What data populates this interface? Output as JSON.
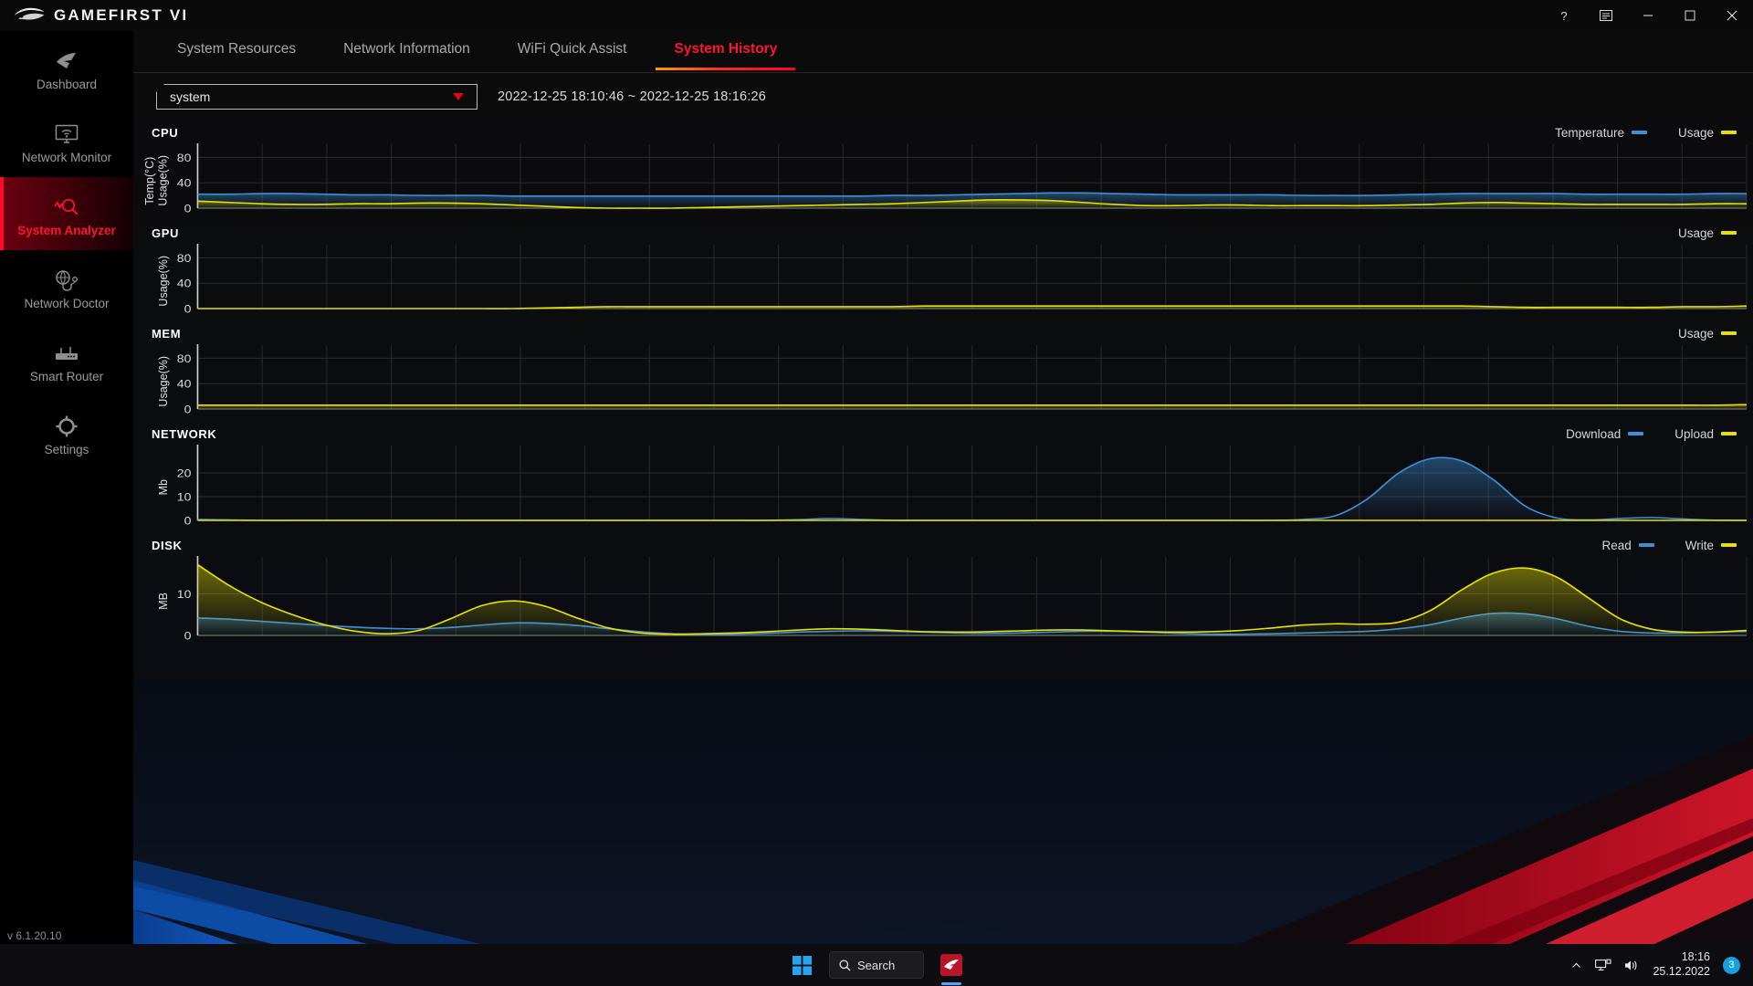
{
  "window": {
    "title": "GAMEFIRST VI",
    "logo_icon": "rog-logo-icon",
    "controls": [
      {
        "name": "help-button",
        "icon": "question-mark-icon",
        "label": "?"
      },
      {
        "name": "notes-button",
        "icon": "note-icon",
        "label": ""
      },
      {
        "name": "minimize-button",
        "icon": "minimize-icon",
        "label": ""
      },
      {
        "name": "maximize-button",
        "icon": "maximize-icon",
        "label": ""
      },
      {
        "name": "close-button",
        "icon": "close-icon",
        "label": ""
      }
    ]
  },
  "sidebar": {
    "items": [
      {
        "label": "Dashboard",
        "icon": "dashboard-icon",
        "active": false
      },
      {
        "label": "Network Monitor",
        "icon": "monitor-wifi-icon",
        "active": false
      },
      {
        "label": "System Analyzer",
        "icon": "magnifier-pulse-icon",
        "active": true
      },
      {
        "label": "Network Doctor",
        "icon": "stethoscope-globe-icon",
        "active": false
      },
      {
        "label": "Smart Router",
        "icon": "router-icon",
        "active": false
      },
      {
        "label": "Settings",
        "icon": "gear-icon",
        "active": false
      }
    ],
    "version": "v 6.1.20.10"
  },
  "tabs": [
    {
      "label": "System Resources",
      "active": false
    },
    {
      "label": "Network Information",
      "active": false
    },
    {
      "label": "WiFi Quick Assist",
      "active": false
    },
    {
      "label": "System History",
      "active": true
    }
  ],
  "toolbar": {
    "profile_select": {
      "value": "system",
      "caret_icon": "chevron-down-icon"
    },
    "time_range": "2022-12-25 18:10:46 ~ 2022-12-25 18:16:26"
  },
  "colors": {
    "accent_red": "#ff1430",
    "series_blue": "#3d8fd8",
    "series_yellow": "#e8e000",
    "grid": "#2a2a2a",
    "background": "#0a0a0a"
  },
  "taskbar": {
    "start_icon": "windows-start-icon",
    "search_label": "Search",
    "search_icon": "search-icon",
    "app_icon": "gamefirst-taskbar-icon",
    "chevron_icon": "chevron-up-icon",
    "network_icon": "network-icon",
    "volume_icon": "volume-icon",
    "time": "18:16",
    "date": "25.12.2022",
    "badge_count": "3"
  },
  "chart_data": [
    {
      "type": "area",
      "title": "CPU",
      "ylabel": "Temp(°C)\nUsage(%)",
      "ylabel_lines": [
        "Temp(°C)",
        "Usage(%)"
      ],
      "yticks": [
        0,
        40,
        80
      ],
      "ylim": [
        0,
        95
      ],
      "grid": true,
      "legend_position": "top-right",
      "series": [
        {
          "name": "Temperature",
          "color": "#3d8fd8",
          "values": [
            22,
            22,
            23,
            23,
            22,
            21,
            21,
            20,
            20,
            20,
            19,
            19,
            19,
            19,
            19,
            19,
            19,
            19,
            19,
            19,
            19,
            19,
            20,
            20,
            21,
            22,
            23,
            24,
            24,
            23,
            22,
            21,
            21,
            21,
            21,
            20,
            20,
            20,
            21,
            22,
            23,
            23,
            23,
            23,
            22,
            22,
            22,
            22,
            23,
            23
          ]
        },
        {
          "name": "Usage",
          "color": "#e8e000",
          "values": [
            11,
            9,
            7,
            6,
            6,
            7,
            7,
            8,
            8,
            7,
            5,
            3,
            1,
            0,
            0,
            0,
            1,
            2,
            3,
            4,
            5,
            6,
            7,
            9,
            11,
            13,
            13,
            12,
            9,
            6,
            4,
            4,
            5,
            5,
            4,
            4,
            4,
            4,
            5,
            6,
            8,
            9,
            8,
            7,
            6,
            6,
            6,
            6,
            7,
            7
          ]
        }
      ]
    },
    {
      "type": "area",
      "title": "GPU",
      "ylabel": "Usage(%)",
      "ylabel_lines": [
        "Usage(%)"
      ],
      "yticks": [
        0,
        40,
        80
      ],
      "ylim": [
        0,
        95
      ],
      "grid": true,
      "legend_position": "top-right",
      "series": [
        {
          "name": "Usage",
          "color": "#e8e000",
          "values": [
            0,
            0,
            0,
            0,
            0,
            0,
            0,
            0,
            0,
            0,
            0,
            1,
            2,
            3,
            3,
            3,
            3,
            3,
            3,
            3,
            3,
            3,
            3,
            4,
            4,
            4,
            4,
            4,
            4,
            4,
            4,
            4,
            4,
            4,
            4,
            4,
            4,
            4,
            4,
            4,
            4,
            3,
            2,
            2,
            2,
            2,
            2,
            3,
            3,
            4
          ]
        }
      ]
    },
    {
      "type": "area",
      "title": "MEM",
      "ylabel": "Usage(%)",
      "ylabel_lines": [
        "Usage(%)"
      ],
      "yticks": [
        0,
        40,
        80
      ],
      "ylim": [
        0,
        95
      ],
      "grid": true,
      "legend_position": "top-right",
      "series": [
        {
          "name": "Usage",
          "color": "#e8e000",
          "values": [
            6,
            6,
            6,
            6,
            6,
            6,
            6,
            6,
            6,
            6,
            6,
            6,
            6,
            6,
            6,
            6,
            6,
            6,
            6,
            6,
            6,
            6,
            6,
            6,
            6,
            6,
            6,
            6,
            6,
            6,
            6,
            6,
            6,
            6,
            6,
            6,
            6,
            6,
            6,
            6,
            6,
            6,
            6,
            6,
            6,
            6,
            6,
            6,
            6,
            7
          ]
        }
      ]
    },
    {
      "type": "area",
      "title": "NETWORK",
      "ylabel": "Mb",
      "ylabel_lines": [
        "Mb"
      ],
      "yticks": [
        0,
        10,
        20
      ],
      "ylim": [
        0,
        30
      ],
      "grid": true,
      "legend_position": "top-right",
      "series": [
        {
          "name": "Download",
          "color": "#3d8fd8",
          "values": [
            0.4,
            0.2,
            0,
            0,
            0,
            0,
            0,
            0,
            0,
            0,
            0,
            0,
            0,
            0,
            0,
            0,
            0,
            0,
            0,
            0.3,
            0.8,
            0.4,
            0,
            0,
            0,
            0,
            0,
            0,
            0,
            0,
            0,
            0,
            0,
            0,
            0,
            0.4,
            2,
            9,
            20,
            26,
            25,
            17,
            6,
            1,
            0.2,
            0.8,
            1.2,
            0.6,
            0.1,
            0
          ]
        },
        {
          "name": "Upload",
          "color": "#e8e000",
          "values": [
            0,
            0,
            0,
            0,
            0,
            0,
            0,
            0,
            0,
            0,
            0,
            0,
            0,
            0,
            0,
            0,
            0,
            0,
            0,
            0,
            0,
            0,
            0,
            0,
            0,
            0,
            0,
            0,
            0,
            0,
            0,
            0,
            0,
            0,
            0,
            0,
            0,
            0,
            0,
            0,
            0,
            0,
            0,
            0,
            0,
            0,
            0,
            0,
            0,
            0
          ]
        }
      ]
    },
    {
      "type": "area",
      "title": "DISK",
      "ylabel": "MB",
      "ylabel_lines": [
        "MB"
      ],
      "yticks": [
        0,
        10
      ],
      "ylim": [
        0,
        18
      ],
      "grid": true,
      "legend_position": "top-right",
      "series": [
        {
          "name": "Read",
          "color": "#3d8fd8",
          "values": [
            4.2,
            3.9,
            3.4,
            2.9,
            2.4,
            2.0,
            1.7,
            1.6,
            1.9,
            2.5,
            3.0,
            2.9,
            2.4,
            1.6,
            0.9,
            0.4,
            0.2,
            0.3,
            0.5,
            0.8,
            1.0,
            1.1,
            1.0,
            0.8,
            0.6,
            0.5,
            0.6,
            0.8,
            1.0,
            1.0,
            0.8,
            0.5,
            0.3,
            0.3,
            0.4,
            0.6,
            0.8,
            1.0,
            1.6,
            2.6,
            4.2,
            5.3,
            5.2,
            4.0,
            2.2,
            1.0,
            0.6,
            0.6,
            0.8,
            1.0
          ]
        },
        {
          "name": "Write",
          "color": "#e8e000",
          "values": [
            17,
            12,
            8,
            5,
            2.6,
            1.0,
            0.4,
            1.2,
            4.0,
            7.2,
            8.3,
            7.0,
            4.2,
            1.8,
            0.6,
            0.3,
            0.4,
            0.6,
            0.9,
            1.3,
            1.6,
            1.5,
            1.2,
            0.9,
            0.8,
            0.9,
            1.1,
            1.3,
            1.3,
            1.1,
            0.9,
            0.8,
            0.9,
            1.2,
            1.8,
            2.5,
            2.8,
            2.7,
            3.2,
            6.0,
            11.0,
            15.0,
            16.2,
            14.0,
            9.0,
            4.0,
            1.5,
            0.8,
            0.8,
            1.2
          ]
        }
      ]
    }
  ]
}
